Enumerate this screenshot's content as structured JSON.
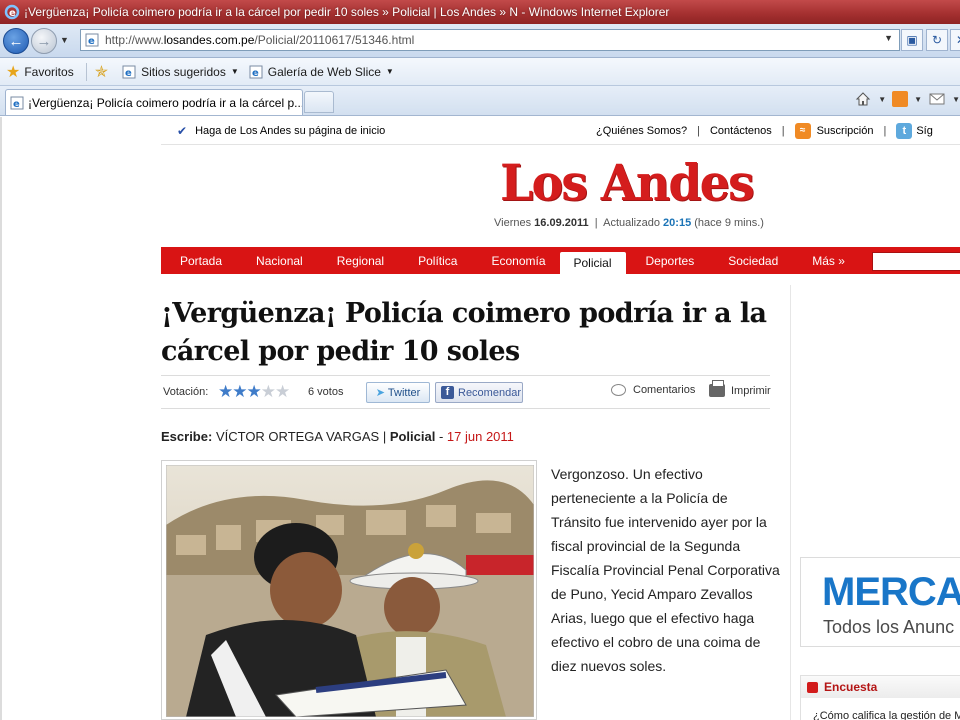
{
  "window": {
    "title": "¡Vergüenza¡ Policía coimero podría ir a la cárcel por pedir 10 soles » Policial | Los Andes » N - Windows Internet Explorer"
  },
  "address": {
    "url_prefix": "http://www.",
    "url_domain": "losandes.com.pe",
    "url_path": "/Policial/20110617/51346.html"
  },
  "favorites_bar": {
    "favorites": "Favoritos",
    "suggested": "Sitios sugeridos",
    "webslice": "Galería de Web Slice"
  },
  "tab": {
    "title": "¡Vergüenza¡ Policía coimero podría ir a la cárcel p..."
  },
  "site_top": {
    "homepage": "Haga de Los Andes su página de inicio",
    "about": "¿Quiénes Somos?",
    "contact": "Contáctenos",
    "subscribe": "Suscripción",
    "follow": "Síg"
  },
  "brand": {
    "logo": "Los Andes",
    "day": "Viernes",
    "date": "16.09.2011",
    "updated_label": "Actualizado",
    "updated_time": "20:15",
    "updated_ago": "(hace 9 mins.)"
  },
  "menu": [
    {
      "label": "Portada"
    },
    {
      "label": "Nacional"
    },
    {
      "label": "Regional"
    },
    {
      "label": "Política"
    },
    {
      "label": "Economía"
    },
    {
      "label": "Policial"
    },
    {
      "label": "Deportes"
    },
    {
      "label": "Sociedad"
    },
    {
      "label": "Más »"
    }
  ],
  "article": {
    "headline": "¡Vergüenza¡ Policía coimero podría ir a la cárcel por pedir 10 soles",
    "vote_label": "Votación:",
    "rating_stars": 3,
    "rating_max": 5,
    "votes": "6 votos",
    "twitter": "Twitter",
    "facebook": "Recomendar",
    "comments": "Comentarios",
    "print": "Imprimir",
    "byline_label": "Escribe:",
    "author": "VÍCTOR ORTEGA VARGAS",
    "section": "Policial",
    "date": "17 jun 2011",
    "body": "Vergonzoso. Un efectivo perteneciente a la Policía de Tránsito fue intervenido ayer por la fiscal provincial de la Segunda Fiscalía Provincial Penal Corporativa de Puno, Yecid Amparo Zevallos Arias, luego que el efectivo haga efectivo el cobro de una coima de diez nuevos soles."
  },
  "sidebar": {
    "ad_big": "MERCA",
    "ad_small": "Todos los Anunc",
    "poll_title": "Encuesta",
    "poll_question": "¿Cómo califica la gestión de M"
  },
  "colors": {
    "brand_red": "#d91414",
    "accent_blue": "#1a73b6"
  }
}
